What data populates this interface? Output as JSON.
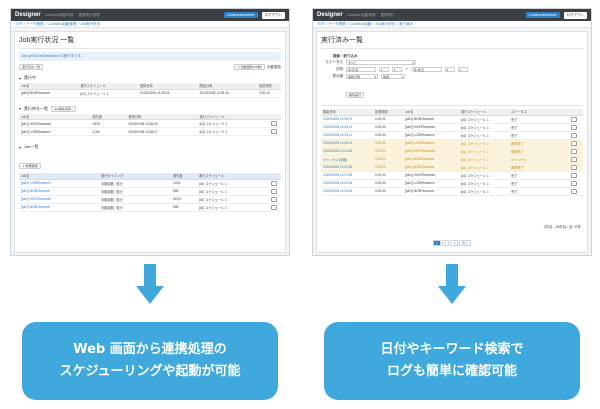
{
  "left_screen": {
    "brand": "Designer",
    "menu": [
      "Condition起動申請",
      "連携実行管理"
    ],
    "user_button": "CollaborateAdmin",
    "logout": "ログアウト",
    "breadcrumb": "TOP > データ連携 > Condition起動管理 > Job実行状況",
    "title": "Job実行状況 一覧",
    "info_message": "Job: jp/HCLWA/research の実行中です。",
    "refresh_button": "実行済み一覧",
    "auto_refresh_label": "自動更新(30秒)",
    "manual_refresh_label": "手動更新",
    "running_section": "実行中",
    "running_headers": [
      "Job名",
      "実行スケジュール",
      "登録日時",
      "開始日時",
      "経過時間"
    ],
    "running_rows": [
      [
        "[job0] MD5Research",
        "[#1] スケジュール 1",
        "2015/03/08 14:35:15",
        "2015/03/08 14:35:16",
        "0:00:15"
      ]
    ],
    "waiting_section": "実行待ち一覧",
    "waiting_button": "Job優先切替...",
    "waiting_headers": [
      "Job名",
      "優先度",
      "登録日時",
      "実行スケジュール"
    ],
    "waiting_rows": [
      [
        "[job1] HIGHResearch",
        "HIGH",
        "2015/03/08 14:35:04",
        "[#1] スケジュール 1"
      ],
      [
        "[job2] LOWResearch",
        "LOW",
        "2015/03/08 14:35:17",
        "[#1] スケジュール 1"
      ]
    ],
    "joblist_section": "Job一覧",
    "add_button": "新規登録",
    "joblist_headers": [
      "Job名",
      "実行タイミング",
      "優先度",
      "実行スケジュール"
    ],
    "joblist_rows": [
      [
        "[job0] LOWResearch",
        "手動起動 / 進行",
        "LOW",
        "[#1] スケジュール 1"
      ],
      [
        "[job1] MD5Research",
        "手動起動 / 進行",
        "MID",
        "[#1] スケジュール 1"
      ],
      [
        "[job2] HIGHResearch",
        "手動起動 / 進行",
        "HIGH",
        "[#1] スケジュール 1"
      ],
      [
        "[job3] MD5Research",
        "手動起動 / 進行",
        "MID",
        "[#1] スケジュール 1"
      ]
    ]
  },
  "right_screen": {
    "brand": "Designer",
    "menu": [
      "Condition起動申請",
      "連携実行"
    ],
    "user_button": "CollaborateAdmin",
    "logout": "ログアウト",
    "breadcrumb": "TOP > データ連携 > Condition起動 > Job実行状況 > 実行済み",
    "title": "実行済み一覧",
    "search_title": "検索・絞り込み",
    "status_label": "ステータス",
    "status_value": "すべて",
    "date_label": "日時",
    "date_from": "年/月/日",
    "date_to": "年/月/日",
    "sort_label": "表示順",
    "sort_value": "開始日時",
    "order_value": "降順",
    "search_button": "検索実行",
    "headers": [
      "開始日時",
      "処理時間",
      "Job名",
      "実行スケジュール",
      "ステータス",
      ""
    ],
    "rows": [
      [
        "2015/03/08 14:35:15",
        "0:00:01",
        "[job0] MD5Research",
        "[#1] スケジュール 1",
        "完了"
      ],
      [
        "2015/03/08 14:35:14",
        "0:00:00",
        "[job0] HIGHResearch",
        "[#1] スケジュール 1",
        "完了"
      ],
      [
        "2015/03/08 14:35:11",
        "0:00:00",
        "[job2] LOWResearch",
        "[#1] スケジュール 1",
        "完了"
      ],
      [
        "2015/03/08 14:35:01",
        "0:00:01",
        "[job3] LOWResearch",
        "[#1] スケジュール 1",
        "異常終了"
      ],
      [
        "2015/03/08 14:34:59",
        "0:00:00",
        "[job0] HIGHResearch",
        "[#1] スケジュール 1",
        "異常終了"
      ],
      [
        "キャンセル(待機)",
        "0:00:00",
        "[job1] MD5Research",
        "[#1] スケジュール 1",
        "キャンセル"
      ],
      [
        "2015/03/08 14:34:56",
        "0:00:01",
        "[job0] MD5Research",
        "[#1] スケジュール 1",
        "異常終了"
      ],
      [
        "2015/03/08 14:34:55",
        "0:00:00",
        "[job1] HIGHResearch",
        "[#1] スケジュール 1",
        "完了"
      ],
      [
        "2015/03/08 14:34:54",
        "0:00:00",
        "[job2] LOWResearch",
        "[#1] スケジュール 1",
        "完了"
      ],
      [
        "2015/03/08 14:34:53",
        "0:00:00",
        "[job3] MD5Research",
        "[#1] スケジュール 1",
        "完了"
      ]
    ],
    "pages": [
      "1",
      "2",
      "3",
      "次へ"
    ],
    "count_text": "1件目 - 10件目 / 全 37件"
  },
  "captions": {
    "left_line1": "Web 画面から連携処理の",
    "left_line2": "スケジューリングや起動が可能",
    "right_line1": "日付やキーワード検索で",
    "right_line2": "ログも簡単に確認可能"
  },
  "colors": {
    "accent": "#3fa8dc",
    "topbar": "#3a3f44",
    "link": "#2f7fc6",
    "warning_row": "#fbf3dc"
  }
}
